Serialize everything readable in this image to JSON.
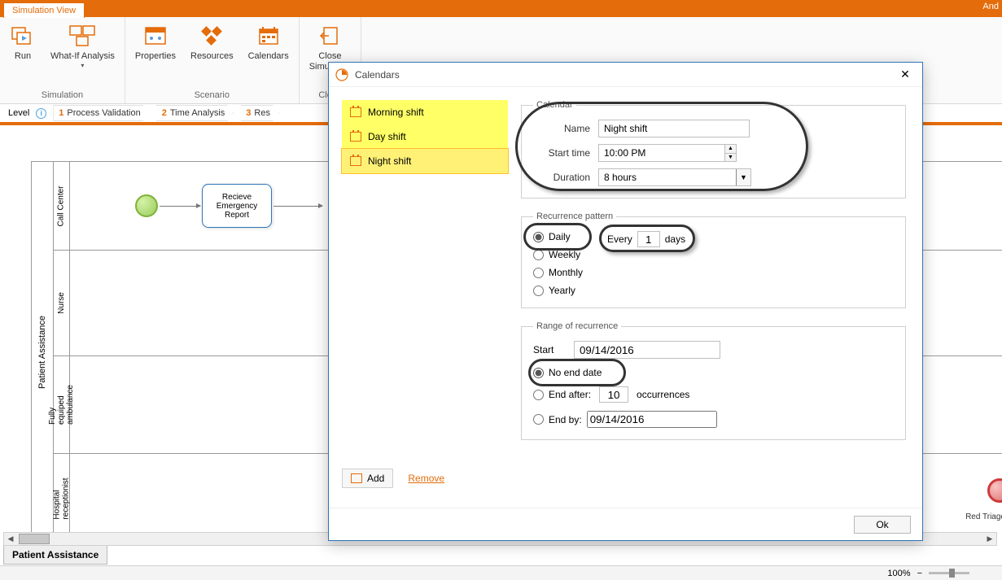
{
  "tab": {
    "active": "Simulation View",
    "user_fragment": "And"
  },
  "ribbon": {
    "simulation": {
      "label": "Simulation",
      "run": "Run",
      "whatif": "What-If Analysis"
    },
    "scenario": {
      "label": "Scenario",
      "properties": "Properties",
      "resources": "Resources",
      "calendars": "Calendars"
    },
    "close": {
      "label": "Close",
      "close_sim": "Close\nSimulation"
    }
  },
  "breadcrumb": {
    "label": "Level",
    "steps": [
      {
        "num": "1",
        "txt": "Process Validation"
      },
      {
        "num": "2",
        "txt": "Time Analysis"
      },
      {
        "num": "3",
        "txt": "Res"
      }
    ]
  },
  "pool": {
    "title": "Patient Assistance",
    "lanes": [
      "Call Center",
      "Nurse",
      "Fully equiped\nambulance",
      "Hospital\nreceptionist"
    ],
    "task1": "Recieve\nEmergency\nReport",
    "red_triage": "Red Triage"
  },
  "doc_tab": "Patient Assistance",
  "status": {
    "zoom": "100%"
  },
  "dialog": {
    "title": "Calendars",
    "shifts": [
      "Morning shift",
      "Day shift",
      "Night shift"
    ],
    "selected_index": 2,
    "add": "Add",
    "remove": "Remove",
    "calendar_legend": "Calendar",
    "name_label": "Name",
    "name_value": "Night shift",
    "start_label": "Start time",
    "start_value": "10:00 PM",
    "duration_label": "Duration",
    "duration_value": "8 hours",
    "pattern_legend": "Recurrence pattern",
    "daily": "Daily",
    "weekly": "Weekly",
    "monthly": "Monthly",
    "yearly": "Yearly",
    "every": "Every",
    "every_n": "1",
    "days": "days",
    "range_legend": "Range of recurrence",
    "range_start_label": "Start",
    "range_start_value": "09/14/2016",
    "no_end": "No end date",
    "end_after": "End after:",
    "end_after_n": "10",
    "occurrences": "occurrences",
    "end_by": "End by:",
    "end_by_value": "09/14/2016",
    "ok": "Ok"
  }
}
